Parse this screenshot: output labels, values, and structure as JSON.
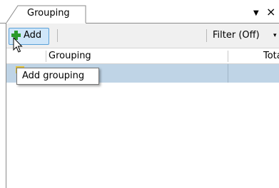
{
  "panel": {
    "tab_label": "Grouping",
    "dropdown_icon": "▼",
    "close_icon": "×"
  },
  "toolbar": {
    "add_label": "Add",
    "filter_label": "Filter (Off)",
    "filter_arrow": "▾"
  },
  "columns": {
    "grouping": "Grouping",
    "total": "Total"
  },
  "tooltip": {
    "text": "Add grouping"
  },
  "colors": {
    "selection_row": "#bfd4e6",
    "add_button_bg": "#cfe6f9",
    "plus_icon": "#2a9a2a"
  }
}
